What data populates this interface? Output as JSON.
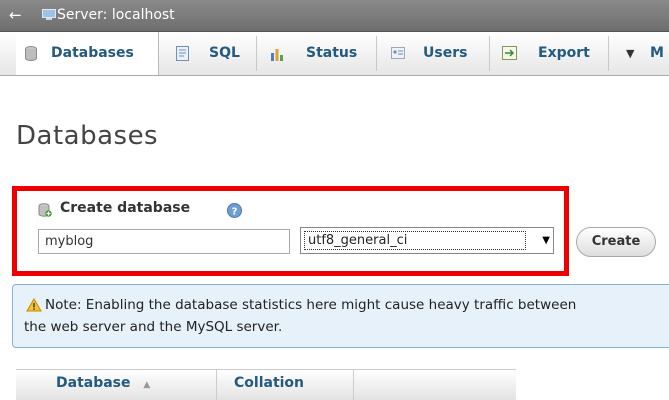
{
  "topbar": {
    "back_glyph": "←",
    "server_label": "Server: localhost"
  },
  "tabs": [
    {
      "label": "Databases",
      "icon": "database-icon",
      "active": true
    },
    {
      "label": "SQL",
      "icon": "sql-icon",
      "active": false
    },
    {
      "label": "Status",
      "icon": "status-icon",
      "active": false
    },
    {
      "label": "Users",
      "icon": "users-icon",
      "active": false
    },
    {
      "label": "Export",
      "icon": "export-icon",
      "active": false
    },
    {
      "label": "M",
      "icon": "more-caret-icon",
      "active": false
    }
  ],
  "page": {
    "title": "Databases"
  },
  "create_db": {
    "heading": "Create database",
    "name_value": "myblog",
    "collation_value": "utf8_general_ci",
    "create_label": "Create"
  },
  "notice": {
    "line1": "Note: Enabling the database statistics here might cause heavy traffic between",
    "line2": "the web server and the MySQL server."
  },
  "table": {
    "columns": [
      "Database",
      "Collation"
    ]
  },
  "colors": {
    "highlight": "#ee0000",
    "link": "#235a81",
    "notice_bg": "#e6f1f9"
  }
}
